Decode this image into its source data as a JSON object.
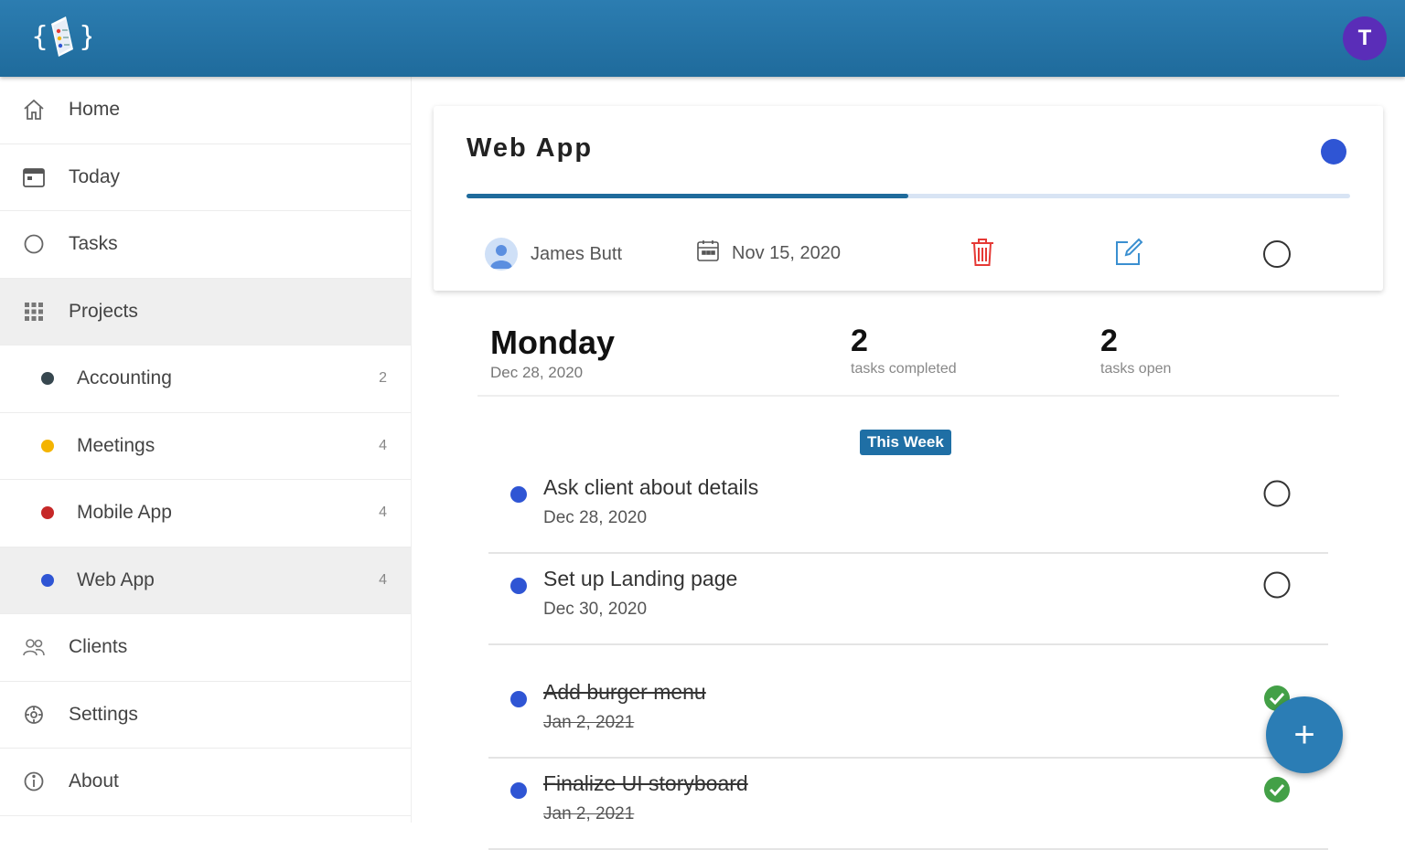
{
  "header": {
    "avatar_initial": "T",
    "accent_color": "#2c7db1"
  },
  "sidebar": {
    "items": [
      {
        "label": "Home",
        "icon": "home-icon"
      },
      {
        "label": "Today",
        "icon": "calendar-icon"
      },
      {
        "label": "Tasks",
        "icon": "circle-icon"
      },
      {
        "label": "Projects",
        "icon": "grid-icon",
        "active": true
      },
      {
        "label": "Accounting",
        "count": "2",
        "color": "#37474f"
      },
      {
        "label": "Meetings",
        "count": "4",
        "color": "#f4b400"
      },
      {
        "label": "Mobile App",
        "count": "4",
        "color": "#c62828"
      },
      {
        "label": "Web App",
        "count": "4",
        "color": "#2f55d4",
        "active": true
      },
      {
        "label": "Clients",
        "icon": "people-icon"
      },
      {
        "label": "Settings",
        "icon": "settings-icon"
      },
      {
        "label": "About",
        "icon": "info-icon"
      }
    ]
  },
  "project": {
    "title": "Web App",
    "color": "#2f55d4",
    "progress_fraction": 0.5,
    "owner": "James Butt",
    "due_date": "Nov 15, 2020"
  },
  "summary": {
    "day": "Monday",
    "date": "Dec 28, 2020",
    "completed_count": "2",
    "completed_label": "tasks completed",
    "open_count": "2",
    "open_label": "tasks open"
  },
  "week_label": "This Week",
  "tasks": [
    {
      "name": "Ask client about details",
      "date": "Dec 28, 2020",
      "done": false
    },
    {
      "name": "Set up Landing page",
      "date": "Dec 30, 2020",
      "done": false
    },
    {
      "name": "Add burger menu",
      "date": "Jan 2, 2021",
      "done": true
    },
    {
      "name": "Finalize UI storyboard",
      "date": "Jan 2, 2021",
      "done": true
    }
  ],
  "fab_label": "+"
}
